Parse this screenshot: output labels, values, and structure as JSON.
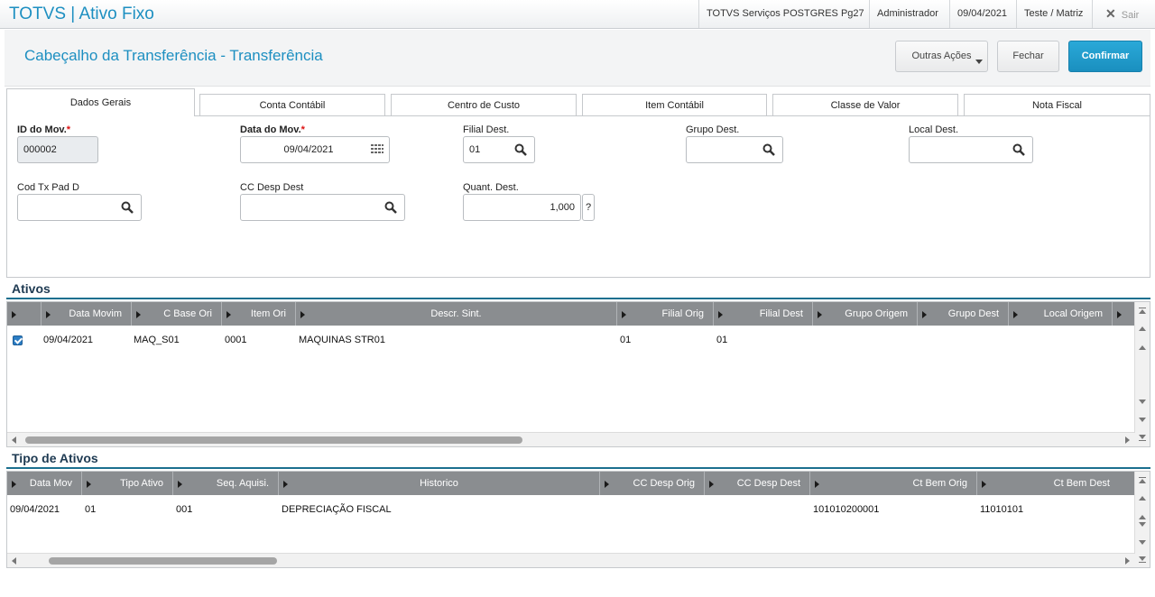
{
  "app": {
    "title": "TOTVS | Ativo Fixo"
  },
  "topbar": {
    "environment": "TOTVS Serviços POSTGRES Pg27",
    "user": "Administrador",
    "date": "09/04/2021",
    "company": "Teste / Matriz",
    "exit_label": "Sair"
  },
  "header": {
    "title": "Cabeçalho da Transferência - Transferência",
    "more_actions_label": "Outras Ações",
    "close_label": "Fechar",
    "confirm_label": "Confirmar"
  },
  "tabs": [
    {
      "label": "Dados Gerais",
      "active": true
    },
    {
      "label": "Conta Contábil"
    },
    {
      "label": "Centro de Custo"
    },
    {
      "label": "Item Contábil"
    },
    {
      "label": "Classe de Valor"
    },
    {
      "label": "Nota Fiscal"
    }
  ],
  "form": {
    "id_mov": {
      "label": "ID do Mov.",
      "value": "000002"
    },
    "data_mov": {
      "label": "Data do Mov.",
      "value": "09/04/2021"
    },
    "filial_dest": {
      "label": "Filial Dest.",
      "value": "01"
    },
    "grupo_dest": {
      "label": "Grupo Dest.",
      "value": ""
    },
    "local_dest": {
      "label": "Local Dest.",
      "value": ""
    },
    "cod_tx": {
      "label": "Cod Tx Pad D",
      "value": ""
    },
    "cc_desp": {
      "label": "CC Desp Dest",
      "value": ""
    },
    "quant": {
      "label": "Quant. Dest.",
      "value": "1,000",
      "help": "?"
    }
  },
  "ativos": {
    "title": "Ativos",
    "columns": [
      "Data Movim",
      "C Base Ori",
      "Item Ori",
      "Descr. Sint.",
      "Filial Orig",
      "Filial Dest",
      "Grupo Origem",
      "Grupo Dest",
      "Local Origem"
    ],
    "rows": [
      {
        "checked": true,
        "data": "09/04/2021",
        "cbase": "MAQ_S01",
        "item": "0001",
        "descr": "MAQUINAS STR01",
        "filial_orig": "01",
        "filial_dest": "01"
      }
    ]
  },
  "tipos": {
    "title": "Tipo de Ativos",
    "columns": [
      "Data Mov",
      "Tipo Ativo",
      "Seq. Aquisi.",
      "Historico",
      "CC Desp Orig",
      "CC Desp Dest",
      "Ct Bem Orig",
      "Ct Bem Dest"
    ],
    "rows": [
      {
        "data": "09/04/2021",
        "tipo": "01",
        "seq": "001",
        "hist": "DEPRECIAÇÃO FISCAL",
        "ct_orig": "101010200001",
        "ct_dest": "11010101"
      }
    ]
  },
  "colors": {
    "accent": "#1d8fc1",
    "primary_button": "#1a8fbf",
    "grid_header": "#8a8d90"
  }
}
